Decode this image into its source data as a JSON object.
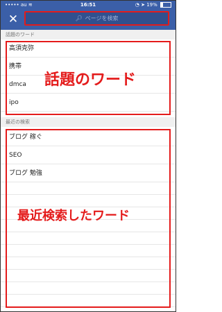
{
  "status": {
    "carrier": "au",
    "time": "16:51",
    "battery": "19%"
  },
  "search": {
    "placeholder": "ページを検索"
  },
  "trending": {
    "header": "話題のワード",
    "items": [
      "高須克弥",
      "携帯",
      "dmca",
      "ipo"
    ],
    "annotation": "話題のワード"
  },
  "recent": {
    "header": "最近の検索",
    "items": [
      "ブログ 稼ぐ",
      "SEO",
      "ブログ 勉強"
    ],
    "annotation": "最近検索したワード"
  },
  "colors": {
    "nav": "#3b5fa8",
    "annotation": "#e41b1b"
  },
  "icons": {
    "close": "close-icon",
    "search": "search-icon",
    "wifi": "wifi-icon",
    "location": "location-icon",
    "alarm": "alarm-icon",
    "battery": "battery-icon"
  }
}
